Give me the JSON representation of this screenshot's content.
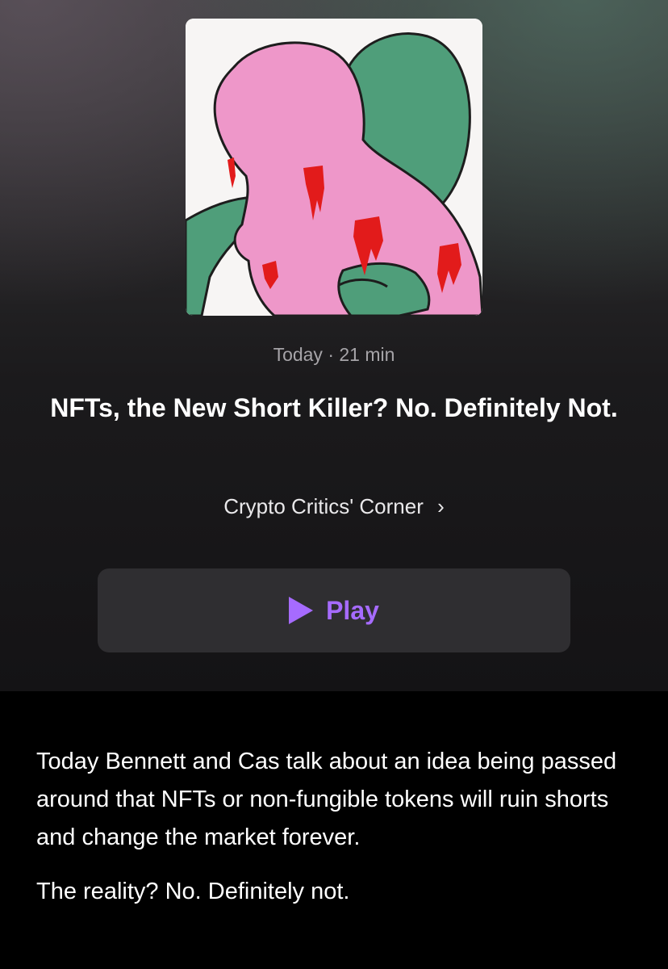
{
  "episode": {
    "date": "Today",
    "separator": "·",
    "duration": "21 min",
    "title": "NFTs, the New Short Killer? No. Definitely Not.",
    "show": "Crypto Critics' Corner",
    "show_chevron": "›"
  },
  "artwork": {
    "icon": "artwork-image",
    "colors": {
      "pink": "#ee97c9",
      "green": "#4f9e7a",
      "blood": "#e21b1b"
    }
  },
  "play": {
    "label": "Play",
    "icon": "play-icon",
    "accent": "#a66bff"
  },
  "description": {
    "paragraphs": [
      "Today Bennett and Cas talk about an idea being passed around that NFTs or non-fungible tokens will ruin shorts and change the market forever.",
      "The reality? No. Definitely not."
    ]
  }
}
